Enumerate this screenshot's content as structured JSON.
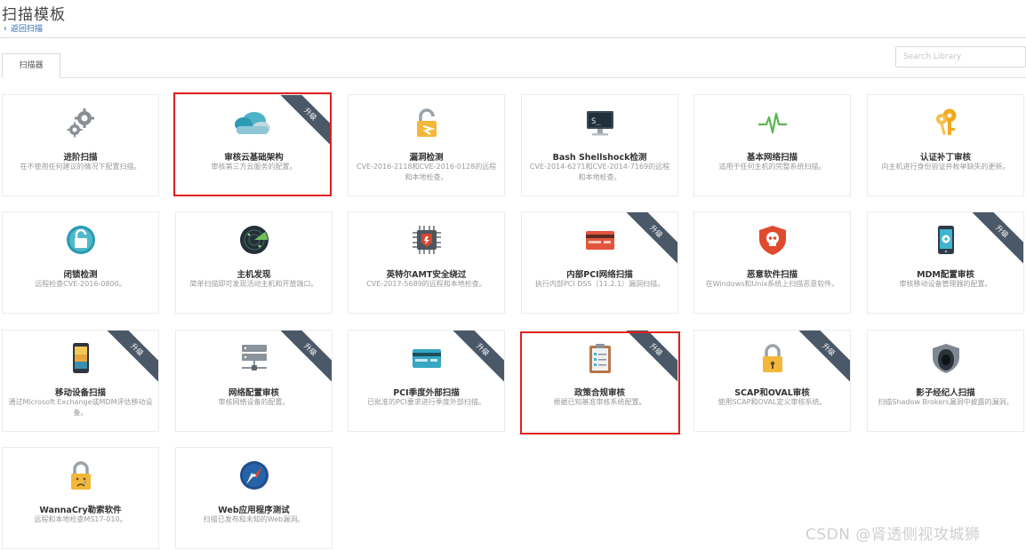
{
  "page": {
    "title": "扫描模板",
    "back_label": "返回扫描",
    "tab_label": "扫描器",
    "search_placeholder": "Search Library"
  },
  "colors": {
    "ribbon": "#4a5867",
    "highlight": "#e02020",
    "link": "#2a6db0"
  },
  "badge_label": "升级",
  "cards": [
    {
      "title": "进阶扫描",
      "desc": "在不使用任何建议的情况下配置扫描。",
      "icon": "gears-icon",
      "upgrade": false
    },
    {
      "title": "审核云基础架构",
      "desc": "审核第三方云服务的配置。",
      "icon": "cloud-icon",
      "upgrade": true
    },
    {
      "title": "漏洞检测",
      "desc": "CVE-2016-2118和CVE-2016-0128的远程和本地检查。",
      "icon": "lock-alert-icon",
      "upgrade": false
    },
    {
      "title": "Bash Shellshock检测",
      "desc": "CVE-2014-6271和CVE-2014-7169的远程和本地检查。",
      "icon": "terminal-icon",
      "upgrade": false
    },
    {
      "title": "基本网络扫描",
      "desc": "适用于任何主机的完整系统扫描。",
      "icon": "pulse-icon",
      "upgrade": false
    },
    {
      "title": "认证补丁审核",
      "desc": "向主机进行身份验证并枚举缺失的更新。",
      "icon": "keys-icon",
      "upgrade": false
    },
    {
      "title": "闭锁检测",
      "desc": "远程检查CVE-2016-0800。",
      "icon": "unlock-circle-icon",
      "upgrade": false
    },
    {
      "title": "主机发现",
      "desc": "简单扫描即可发现活动主机和开放端口。",
      "icon": "radar-icon",
      "upgrade": false
    },
    {
      "title": "英特尔AMT安全绕过",
      "desc": "CVE-2017-5689的远程和本地检查。",
      "icon": "chip-icon",
      "upgrade": false
    },
    {
      "title": "内部PCI网络扫描",
      "desc": "执行内部PCI DSS（11.2.1）漏洞扫描。",
      "icon": "credit-card-icon",
      "upgrade": true
    },
    {
      "title": "恶意软件扫描",
      "desc": "在Windows和Unix系统上扫描恶意软件。",
      "icon": "skull-shield-icon",
      "upgrade": false
    },
    {
      "title": "MDM配置审核",
      "desc": "审核移动设备管理器的配置。",
      "icon": "mobile-gear-icon",
      "upgrade": true
    },
    {
      "title": "移动设备扫描",
      "desc": "通过Microsoft Exchange或MDM评估移动设备。",
      "icon": "smartphone-icon",
      "upgrade": true
    },
    {
      "title": "网络配置审核",
      "desc": "审核网络设备的配置。",
      "icon": "server-icon",
      "upgrade": true
    },
    {
      "title": "PCI季度外部扫描",
      "desc": "已批准的PCI要求进行季度外部扫描。",
      "icon": "credit-card-blue-icon",
      "upgrade": true
    },
    {
      "title": "政策合规审核",
      "desc": "根据已知基准审核系统配置。",
      "icon": "clipboard-icon",
      "upgrade": true
    },
    {
      "title": "SCAP和OVAL审核",
      "desc": "使用SCAP和OVAL定义审核系统。",
      "icon": "lock-icon",
      "upgrade": true
    },
    {
      "title": "影子经纪人扫描",
      "desc": "扫描Shadow Brokers漏洞中披露的漏洞。",
      "icon": "hooded-figure-icon",
      "upgrade": false
    },
    {
      "title": "WannaCry勒索软件",
      "desc": "远程和本地检查MS17-010。",
      "icon": "crying-lock-icon",
      "upgrade": false
    },
    {
      "title": "Web应用程序测试",
      "desc": "扫描已发布和未知的Web漏洞。",
      "icon": "compass-icon",
      "upgrade": false
    }
  ],
  "watermark": "CSDN @肾透侧视攻城狮"
}
